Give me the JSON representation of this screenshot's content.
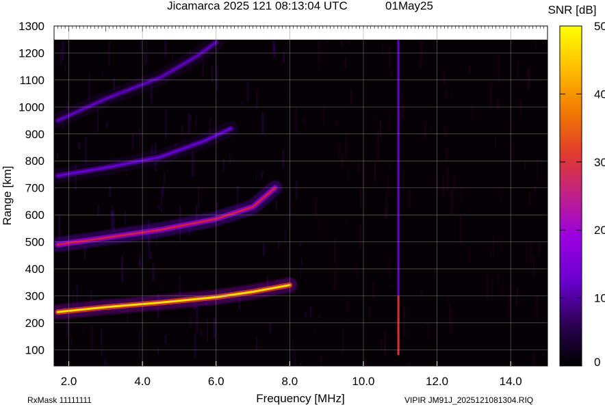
{
  "chart_data": {
    "type": "heatmap",
    "title": "Jicamarca 2025 121 08:13:04 UTC",
    "date_label": "01May25",
    "xlabel": "Frequency [MHz]",
    "ylabel": "Range [km]",
    "colorbar_label": "SNR [dB]",
    "xlim": [
      1.6,
      15.0
    ],
    "ylim": [
      40,
      1300
    ],
    "x_ticks": [
      "2.0",
      "4.0",
      "6.0",
      "8.0",
      "10.0",
      "12.0",
      "14.0"
    ],
    "y_ticks": [
      "100",
      "200",
      "300",
      "400",
      "500",
      "600",
      "700",
      "800",
      "900",
      "1000",
      "1100",
      "1200",
      "1300"
    ],
    "colorbar_ticks": [
      "0",
      "10",
      "20",
      "30",
      "40",
      "50"
    ],
    "clim": [
      0,
      50
    ],
    "grid": true,
    "colormap": [
      "#000000",
      "#3a0070",
      "#7a00ff",
      "#a000c0",
      "#d02040",
      "#f07000",
      "#ffd000",
      "#ffff00"
    ],
    "echo_traces": [
      {
        "points": [
          [
            1.7,
            240
          ],
          [
            3.0,
            258
          ],
          [
            4.5,
            275
          ],
          [
            6.0,
            295
          ],
          [
            7.0,
            315
          ],
          [
            8.0,
            340
          ]
        ],
        "peak_snr": 45
      },
      {
        "points": [
          [
            1.7,
            490
          ],
          [
            3.0,
            515
          ],
          [
            4.5,
            545
          ],
          [
            6.0,
            585
          ],
          [
            7.0,
            630
          ],
          [
            7.6,
            700
          ]
        ],
        "peak_snr": 28
      },
      {
        "points": [
          [
            1.7,
            745
          ],
          [
            3.0,
            775
          ],
          [
            4.5,
            815
          ],
          [
            5.7,
            875
          ],
          [
            6.4,
            920
          ]
        ],
        "peak_snr": 12
      },
      {
        "points": [
          [
            1.7,
            950
          ],
          [
            3.0,
            1030
          ],
          [
            4.5,
            1110
          ],
          [
            5.5,
            1190
          ],
          [
            6.0,
            1240
          ]
        ],
        "peak_snr": 11
      }
    ],
    "interference_lines": [
      {
        "freq": 10.95,
        "peak_snr": 30
      }
    ]
  },
  "footer": {
    "rx_mask": "RxMask 11111111",
    "file_label": "VIPIR  JM91J_2025121081304.RIQ"
  }
}
